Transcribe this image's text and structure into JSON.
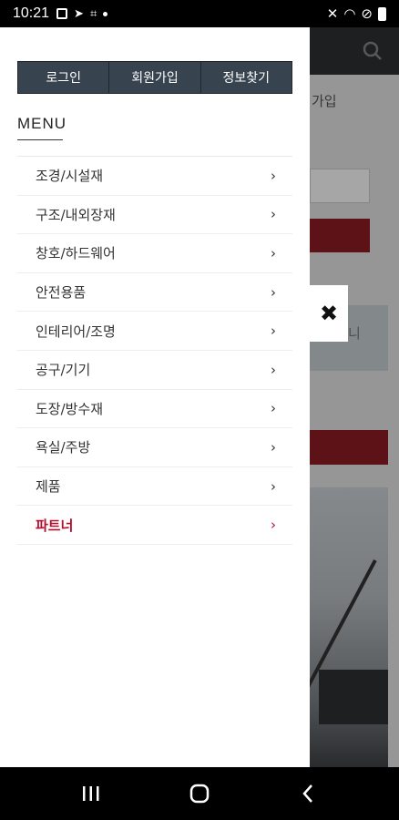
{
  "status_bar": {
    "time": "10:21"
  },
  "background": {
    "signup_text": "가입"
  },
  "drawer": {
    "auth_buttons": [
      "로그인",
      "회원가입",
      "정보찾기"
    ],
    "menu_title": "MENU",
    "menu_items": [
      {
        "label": "조경/시설재"
      },
      {
        "label": "구조/내외장재"
      },
      {
        "label": "창호/하드웨어"
      },
      {
        "label": "안전용품"
      },
      {
        "label": "인테리어/조명"
      },
      {
        "label": "공구/기기"
      },
      {
        "label": "도장/방수재"
      },
      {
        "label": "욕실/주방"
      },
      {
        "label": "제품"
      },
      {
        "label": "파트너"
      }
    ],
    "chevron": "›",
    "highlight_color": "#b3102e"
  },
  "close_button": {
    "symbol": "✖"
  }
}
